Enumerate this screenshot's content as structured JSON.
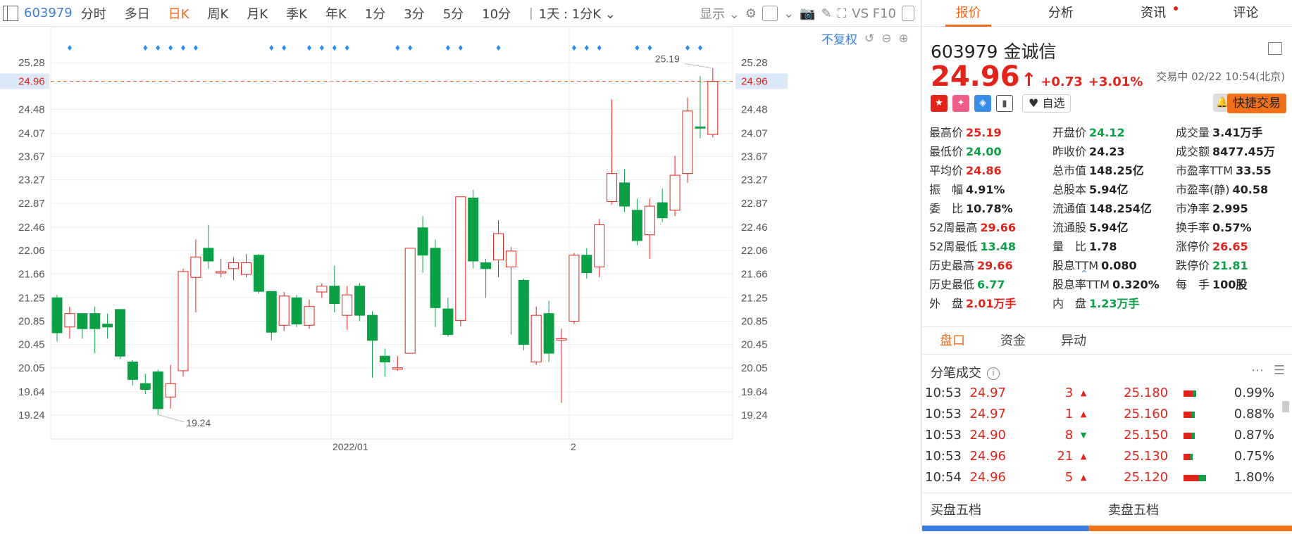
{
  "toolbar": {
    "code": "603979",
    "periods": [
      "分时",
      "多日",
      "日K",
      "周K",
      "月K",
      "季K",
      "年K",
      "1分",
      "3分",
      "5分",
      "10分"
    ],
    "active_period": "日K",
    "interval": "1天 : 1分K",
    "display": "显示",
    "f10": "VS F10"
  },
  "chart_controls": {
    "adjust": "不复权"
  },
  "chart_data": {
    "type": "candlestick",
    "y_ticks": [
      "25.28",
      "24.96",
      "24.48",
      "24.07",
      "23.67",
      "23.27",
      "22.87",
      "22.46",
      "22.06",
      "21.66",
      "21.25",
      "20.85",
      "20.45",
      "20.05",
      "19.64",
      "19.24"
    ],
    "current_price_label": "24.96",
    "x_labels": [
      "2022/01",
      "2"
    ],
    "high_label": "25.19",
    "low_label": "19.24",
    "ylim": [
      19.0,
      25.5
    ],
    "candles": [
      [
        21.25,
        20.65,
        21.3,
        20.5
      ],
      [
        20.75,
        20.98,
        21.1,
        20.55
      ],
      [
        20.98,
        20.72,
        20.98,
        20.55
      ],
      [
        20.98,
        20.72,
        21.1,
        20.3
      ],
      [
        20.8,
        20.75,
        20.98,
        20.55
      ],
      [
        21.05,
        20.25,
        21.05,
        20.2
      ],
      [
        20.15,
        19.85,
        20.18,
        19.75
      ],
      [
        19.78,
        19.68,
        19.95,
        19.6
      ],
      [
        19.98,
        19.35,
        20.02,
        19.24
      ],
      [
        19.55,
        19.78,
        20.1,
        19.35
      ],
      [
        20.0,
        21.7,
        21.75,
        19.9
      ],
      [
        21.6,
        21.95,
        22.25,
        21.0
      ],
      [
        22.1,
        21.88,
        22.5,
        21.75
      ],
      [
        21.7,
        21.7,
        21.92,
        21.6
      ],
      [
        21.75,
        21.85,
        21.95,
        21.55
      ],
      [
        21.65,
        21.85,
        22.0,
        21.6
      ],
      [
        21.98,
        21.36,
        22.0,
        21.32
      ],
      [
        21.36,
        20.66,
        21.36,
        20.52
      ],
      [
        20.78,
        21.28,
        21.35,
        20.68
      ],
      [
        21.25,
        20.8,
        21.3,
        20.75
      ],
      [
        20.78,
        21.1,
        21.22,
        20.72
      ],
      [
        21.35,
        21.45,
        21.5,
        21.25
      ],
      [
        21.45,
        21.15,
        21.8,
        21.0
      ],
      [
        20.95,
        21.3,
        21.45,
        20.7
      ],
      [
        21.45,
        20.95,
        21.5,
        20.85
      ],
      [
        20.95,
        20.52,
        21.02,
        19.88
      ],
      [
        20.25,
        20.15,
        20.38,
        19.9
      ],
      [
        20.05,
        20.05,
        20.25,
        20.0
      ],
      [
        20.3,
        22.1,
        22.1,
        20.3
      ],
      [
        22.45,
        21.98,
        22.65,
        21.68
      ],
      [
        22.1,
        21.08,
        22.25,
        20.75
      ],
      [
        21.06,
        20.62,
        21.25,
        20.58
      ],
      [
        20.86,
        22.98,
        22.98,
        20.76
      ],
      [
        22.96,
        21.88,
        23.1,
        21.75
      ],
      [
        21.85,
        21.75,
        21.92,
        21.25
      ],
      [
        21.9,
        22.35,
        22.58,
        21.6
      ],
      [
        21.78,
        22.05,
        22.12,
        20.62
      ],
      [
        21.55,
        20.45,
        21.58,
        20.35
      ],
      [
        20.15,
        20.95,
        21.1,
        20.1
      ],
      [
        20.98,
        20.3,
        21.2,
        20.15
      ],
      [
        20.55,
        20.55,
        20.72,
        19.45
      ],
      [
        20.85,
        21.98,
        22.02,
        20.8
      ],
      [
        21.98,
        21.68,
        22.1,
        21.58
      ],
      [
        21.78,
        22.5,
        22.6,
        21.6
      ],
      [
        22.9,
        23.38,
        24.65,
        22.85
      ],
      [
        23.22,
        22.82,
        23.45,
        22.72
      ],
      [
        22.75,
        22.23,
        22.95,
        22.15
      ],
      [
        22.33,
        22.82,
        22.95,
        21.92
      ],
      [
        22.88,
        22.62,
        23.12,
        22.55
      ],
      [
        22.75,
        23.35,
        23.68,
        22.65
      ],
      [
        23.38,
        24.45,
        24.68,
        23.22
      ],
      [
        24.18,
        24.16,
        25.05,
        23.98
      ],
      [
        24.05,
        24.96,
        25.19,
        24.0
      ]
    ]
  },
  "stock": {
    "code": "603979",
    "name": "金诚信",
    "price": "24.96",
    "change": "+0.73",
    "change_pct": "+3.01%",
    "status": "交易中 02/22 10:54(北京)",
    "watch": "自选",
    "quick_trade": "快捷交易"
  },
  "right_tabs": [
    "报价",
    "分析",
    "资讯",
    "评论"
  ],
  "quotes": [
    {
      "label": "最高价",
      "value": "25.19",
      "c": "red"
    },
    {
      "label": "开盘价",
      "value": "24.12",
      "c": "green"
    },
    {
      "label": "成交量",
      "value": "3.41万手",
      "c": "dark"
    },
    {
      "label": "最低价",
      "value": "24.00",
      "c": "green"
    },
    {
      "label": "昨收价",
      "value": "24.23",
      "c": "dark"
    },
    {
      "label": "成交额",
      "value": "8477.45万",
      "c": "dark"
    },
    {
      "label": "平均价",
      "value": "24.86",
      "c": "red"
    },
    {
      "label": "总市值",
      "value": "148.25亿",
      "c": "dark"
    },
    {
      "label": "市盈率TTM",
      "value": "33.55",
      "c": "dark"
    },
    {
      "label": "振　幅",
      "value": "4.91%",
      "c": "dark"
    },
    {
      "label": "总股本",
      "value": "5.94亿",
      "c": "dark"
    },
    {
      "label": "市盈率(静)",
      "value": "40.58",
      "c": "dark"
    },
    {
      "label": "委　比",
      "value": "10.78%",
      "c": "dark"
    },
    {
      "label": "流通值",
      "value": "148.254亿",
      "c": "dark"
    },
    {
      "label": "市净率",
      "value": "2.995",
      "c": "dark"
    },
    {
      "label": "52周最高",
      "value": "29.66",
      "c": "red"
    },
    {
      "label": "流通股",
      "value": "5.94亿",
      "c": "dark"
    },
    {
      "label": "换手率",
      "value": "0.57%",
      "c": "dark"
    },
    {
      "label": "52周最低",
      "value": "13.48",
      "c": "green"
    },
    {
      "label": "量　比",
      "value": "1.78",
      "c": "dark"
    },
    {
      "label": "涨停价",
      "value": "26.65",
      "c": "red"
    },
    {
      "label": "历史最高",
      "value": "29.66",
      "c": "red"
    },
    {
      "label": "股息TTM",
      "value": "0.080",
      "c": "dark"
    },
    {
      "label": "跌停价",
      "value": "21.81",
      "c": "green"
    },
    {
      "label": "历史最低",
      "value": "6.77",
      "c": "green"
    },
    {
      "label": "股息率TTM",
      "value": "0.320%",
      "c": "dark"
    },
    {
      "label": "每　手",
      "value": "100股",
      "c": "dark"
    },
    {
      "label": "外　盘",
      "value": "2.01万手",
      "c": "red"
    },
    {
      "label": "内　盘",
      "value": "1.23万手",
      "c": "green"
    },
    {
      "label": "",
      "value": "",
      "c": "dark"
    }
  ],
  "sub_tabs": [
    "盘口",
    "资金",
    "异动"
  ],
  "trades_title": "分笔成交",
  "trades": [
    {
      "time": "10:53",
      "price": "24.97",
      "vol": "3",
      "dir": "up",
      "ask": "25.180",
      "pct": "0.99%",
      "bar": 0.45
    },
    {
      "time": "10:53",
      "price": "24.97",
      "vol": "1",
      "dir": "up",
      "ask": "25.160",
      "pct": "0.88%",
      "bar": 0.4
    },
    {
      "time": "10:53",
      "price": "24.90",
      "vol": "8",
      "dir": "down",
      "ask": "25.150",
      "pct": "0.87%",
      "bar": 0.38
    },
    {
      "time": "10:53",
      "price": "24.96",
      "vol": "21",
      "dir": "up",
      "ask": "25.130",
      "pct": "0.75%",
      "bar": 0.33
    },
    {
      "time": "10:54",
      "price": "24.96",
      "vol": "5",
      "dir": "up",
      "ask": "25.120",
      "pct": "1.80%",
      "bar": 0.8
    }
  ],
  "book": {
    "buy": "买盘五档",
    "sell": "卖盘五档"
  },
  "colors": {
    "up": "#e2231a",
    "down": "#0ca046",
    "accent": "#f1691c",
    "grid": "#eeeeee"
  }
}
